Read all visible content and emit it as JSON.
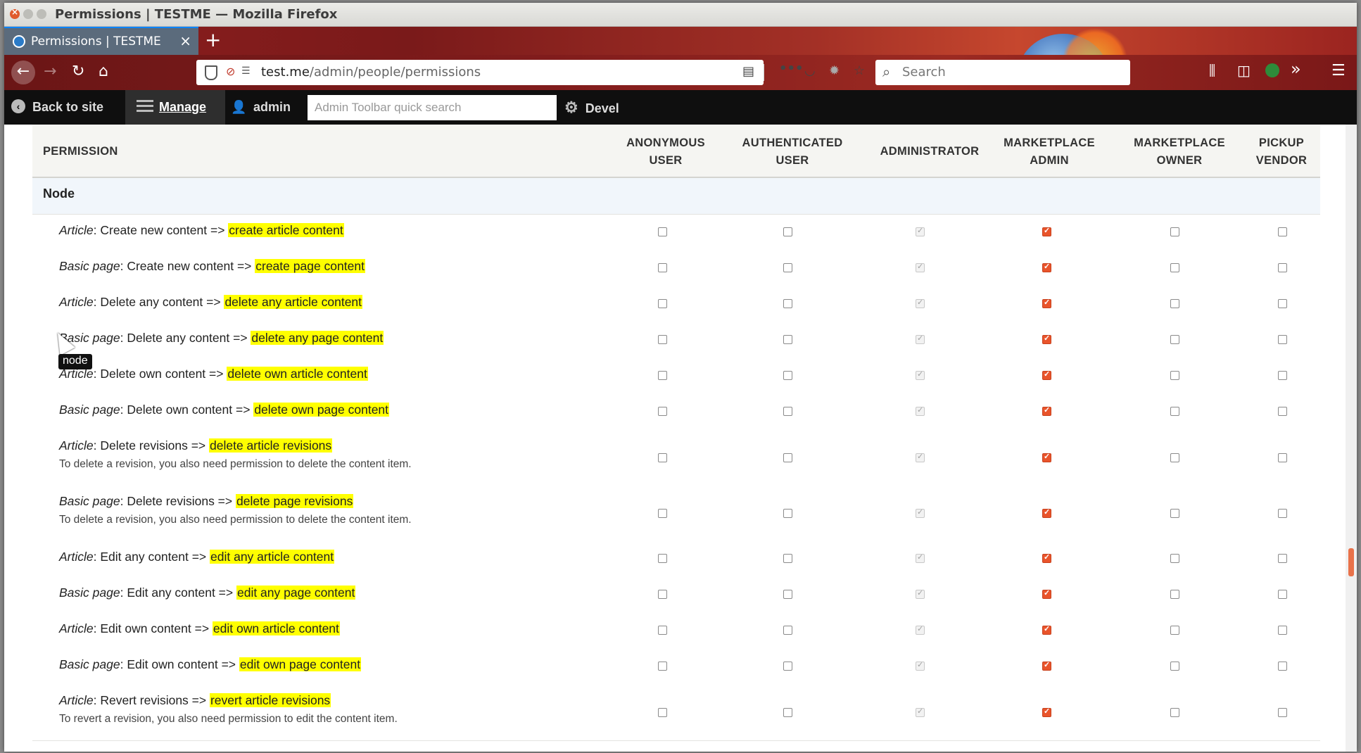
{
  "window": {
    "title": "Permissions | TESTME — Mozilla Firefox"
  },
  "tabs": [
    {
      "label": "Permissions | TESTME",
      "close": "×"
    }
  ],
  "new_tab_label": "+",
  "url": {
    "host": "test.me",
    "path": "/admin/people/permissions"
  },
  "search": {
    "placeholder": "Search"
  },
  "admin_toolbar": {
    "back_to_site": "Back to site",
    "manage": "Manage",
    "user": "admin",
    "search_placeholder": "Admin Toolbar quick search",
    "devel": "Devel"
  },
  "table": {
    "headers": {
      "permission": "Permission",
      "anon": "Anonymous user",
      "auth": "Authenticated user",
      "admin": "Administrator",
      "mkadmin": "Marketplace admin",
      "mkowner": "Marketplace owner",
      "pickup": "Pickup vendor"
    },
    "section": "Node",
    "rows": [
      {
        "type": "Article",
        "label": ": Create new content => ",
        "machine": "create article content",
        "desc": ""
      },
      {
        "type": "Basic page",
        "label": ": Create new content => ",
        "machine": "create page content",
        "desc": ""
      },
      {
        "type": "Article",
        "label": ": Delete any content => ",
        "machine": "delete any article content",
        "desc": ""
      },
      {
        "type": "Basic page",
        "label": ": Delete any content => ",
        "machine": "delete any page content",
        "desc": ""
      },
      {
        "type": "Article",
        "label": ": Delete own content => ",
        "machine": "delete own article content",
        "desc": ""
      },
      {
        "type": "Basic page",
        "label": ": Delete own content => ",
        "machine": "delete own page content",
        "desc": ""
      },
      {
        "type": "Article",
        "label": ": Delete revisions => ",
        "machine": "delete article revisions",
        "desc": "To delete a revision, you also need permission to delete the content item."
      },
      {
        "type": "Basic page",
        "label": ": Delete revisions => ",
        "machine": "delete page revisions",
        "desc": "To delete a revision, you also need permission to delete the content item."
      },
      {
        "type": "Article",
        "label": ": Edit any content => ",
        "machine": "edit any article content",
        "desc": ""
      },
      {
        "type": "Basic page",
        "label": ": Edit any content => ",
        "machine": "edit any page content",
        "desc": ""
      },
      {
        "type": "Article",
        "label": ": Edit own content => ",
        "machine": "edit own article content",
        "desc": ""
      },
      {
        "type": "Basic page",
        "label": ": Edit own content => ",
        "machine": "edit own page content",
        "desc": ""
      },
      {
        "type": "Article",
        "label": ": Revert revisions => ",
        "machine": "revert article revisions",
        "desc": "To revert a revision, you also need permission to edit the content item."
      }
    ],
    "column_state": {
      "anon": "unchecked",
      "auth": "unchecked",
      "admin": "checked-disabled",
      "mkadmin": "checked",
      "mkowner": "unchecked",
      "pickup": "unchecked"
    }
  },
  "tooltip": "node",
  "colors": {
    "accent": "#e9542b",
    "highlight": "#ffff00",
    "toolbar": "#0f0f0f"
  }
}
